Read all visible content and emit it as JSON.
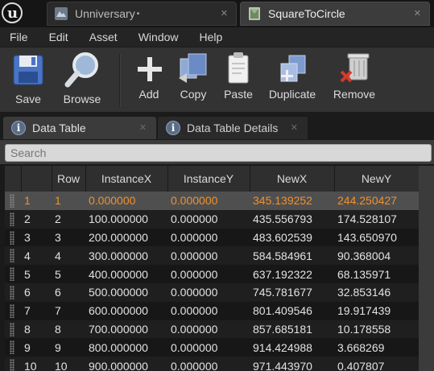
{
  "document_tabs": [
    {
      "label": "Unniversary",
      "modified_marker": "•",
      "close": "✕"
    },
    {
      "label": "SquareToCircle",
      "close": "✕"
    }
  ],
  "menu": [
    "File",
    "Edit",
    "Asset",
    "Window",
    "Help"
  ],
  "toolbar": {
    "save": "Save",
    "browse": "Browse",
    "add": "Add",
    "copy": "Copy",
    "paste": "Paste",
    "duplicate": "Duplicate",
    "remove": "Remove"
  },
  "panel_tabs": [
    {
      "label": "Data Table",
      "close": "✕"
    },
    {
      "label": "Data Table Details",
      "close": "✕"
    }
  ],
  "search": {
    "placeholder": "Search"
  },
  "table": {
    "columns": [
      "",
      "Row",
      "InstanceX",
      "InstanceY",
      "NewX",
      "NewY"
    ],
    "rows": [
      {
        "index": "1",
        "row": "1",
        "instance_x": "0.000000",
        "instance_y": "0.000000",
        "new_x": "345.139252",
        "new_y": "244.250427",
        "selected": true
      },
      {
        "index": "2",
        "row": "2",
        "instance_x": "100.000000",
        "instance_y": "0.000000",
        "new_x": "435.556793",
        "new_y": "174.528107"
      },
      {
        "index": "3",
        "row": "3",
        "instance_x": "200.000000",
        "instance_y": "0.000000",
        "new_x": "483.602539",
        "new_y": "143.650970"
      },
      {
        "index": "4",
        "row": "4",
        "instance_x": "300.000000",
        "instance_y": "0.000000",
        "new_x": "584.584961",
        "new_y": "90.368004"
      },
      {
        "index": "5",
        "row": "5",
        "instance_x": "400.000000",
        "instance_y": "0.000000",
        "new_x": "637.192322",
        "new_y": "68.135971"
      },
      {
        "index": "6",
        "row": "6",
        "instance_x": "500.000000",
        "instance_y": "0.000000",
        "new_x": "745.781677",
        "new_y": "32.853146"
      },
      {
        "index": "7",
        "row": "7",
        "instance_x": "600.000000",
        "instance_y": "0.000000",
        "new_x": "801.409546",
        "new_y": "19.917439"
      },
      {
        "index": "8",
        "row": "8",
        "instance_x": "700.000000",
        "instance_y": "0.000000",
        "new_x": "857.685181",
        "new_y": "10.178558"
      },
      {
        "index": "9",
        "row": "9",
        "instance_x": "800.000000",
        "instance_y": "0.000000",
        "new_x": "914.424988",
        "new_y": "3.668269"
      },
      {
        "index": "10",
        "row": "10",
        "instance_x": "900.000000",
        "instance_y": "0.000000",
        "new_x": "971.443970",
        "new_y": "0.407807"
      }
    ]
  },
  "colors": {
    "selection_text": "#f0912c",
    "selection_row": "#4f4f4f",
    "background": "#1a1a1a"
  }
}
